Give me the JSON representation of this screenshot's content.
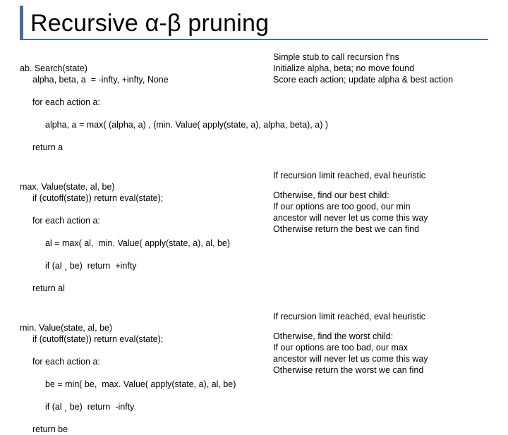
{
  "title": "Recursive α-β pruning",
  "abSearch": {
    "sig": "ab. Search(state)",
    "l1": "alpha, beta, a  = -infty, +infty, None",
    "l2": "for each action a:",
    "l3": "alpha, a = max( (alpha, a) , (min. Value( apply(state, a), alpha, beta), a) )",
    "l4": "return a",
    "n1": "Simple stub to call recursion f'ns",
    "n2": "Initialize alpha, beta; no move found",
    "n3": "Score each action; update alpha & best action"
  },
  "maxValue": {
    "sig": "max. Value(state, al, be)",
    "l1": "if (cutoff(state)) return eval(state);",
    "l2": "for each action a:",
    "l3": "al = max( al,  min. Value( apply(state, a), al, be)",
    "l4": "if (al ¸ be)  return  +infty",
    "l5": "return al",
    "n1": "If recursion limit reached, eval heuristic",
    "n2": "Otherwise, find our best child:",
    "n3": "If our options are too good, our min",
    "n4": "  ancestor will never let us come this way",
    "n5": "Otherwise return the best we can find"
  },
  "minValue": {
    "sig": "min. Value(state, al, be)",
    "l1": "if (cutoff(state)) return eval(state);",
    "l2": "for each action a:",
    "l3": "be = min( be,  max. Value( apply(state, a), al, be)",
    "l4": "if (al ¸ be)  return  -infty",
    "l5": "return be",
    "n1": "If recursion limit reached, eval heuristic",
    "n2": "Otherwise, find the worst child:",
    "n3": "If our options are too bad, our max",
    "n4": "  ancestor will never let us come this way",
    "n5": "Otherwise return the worst we can find"
  }
}
